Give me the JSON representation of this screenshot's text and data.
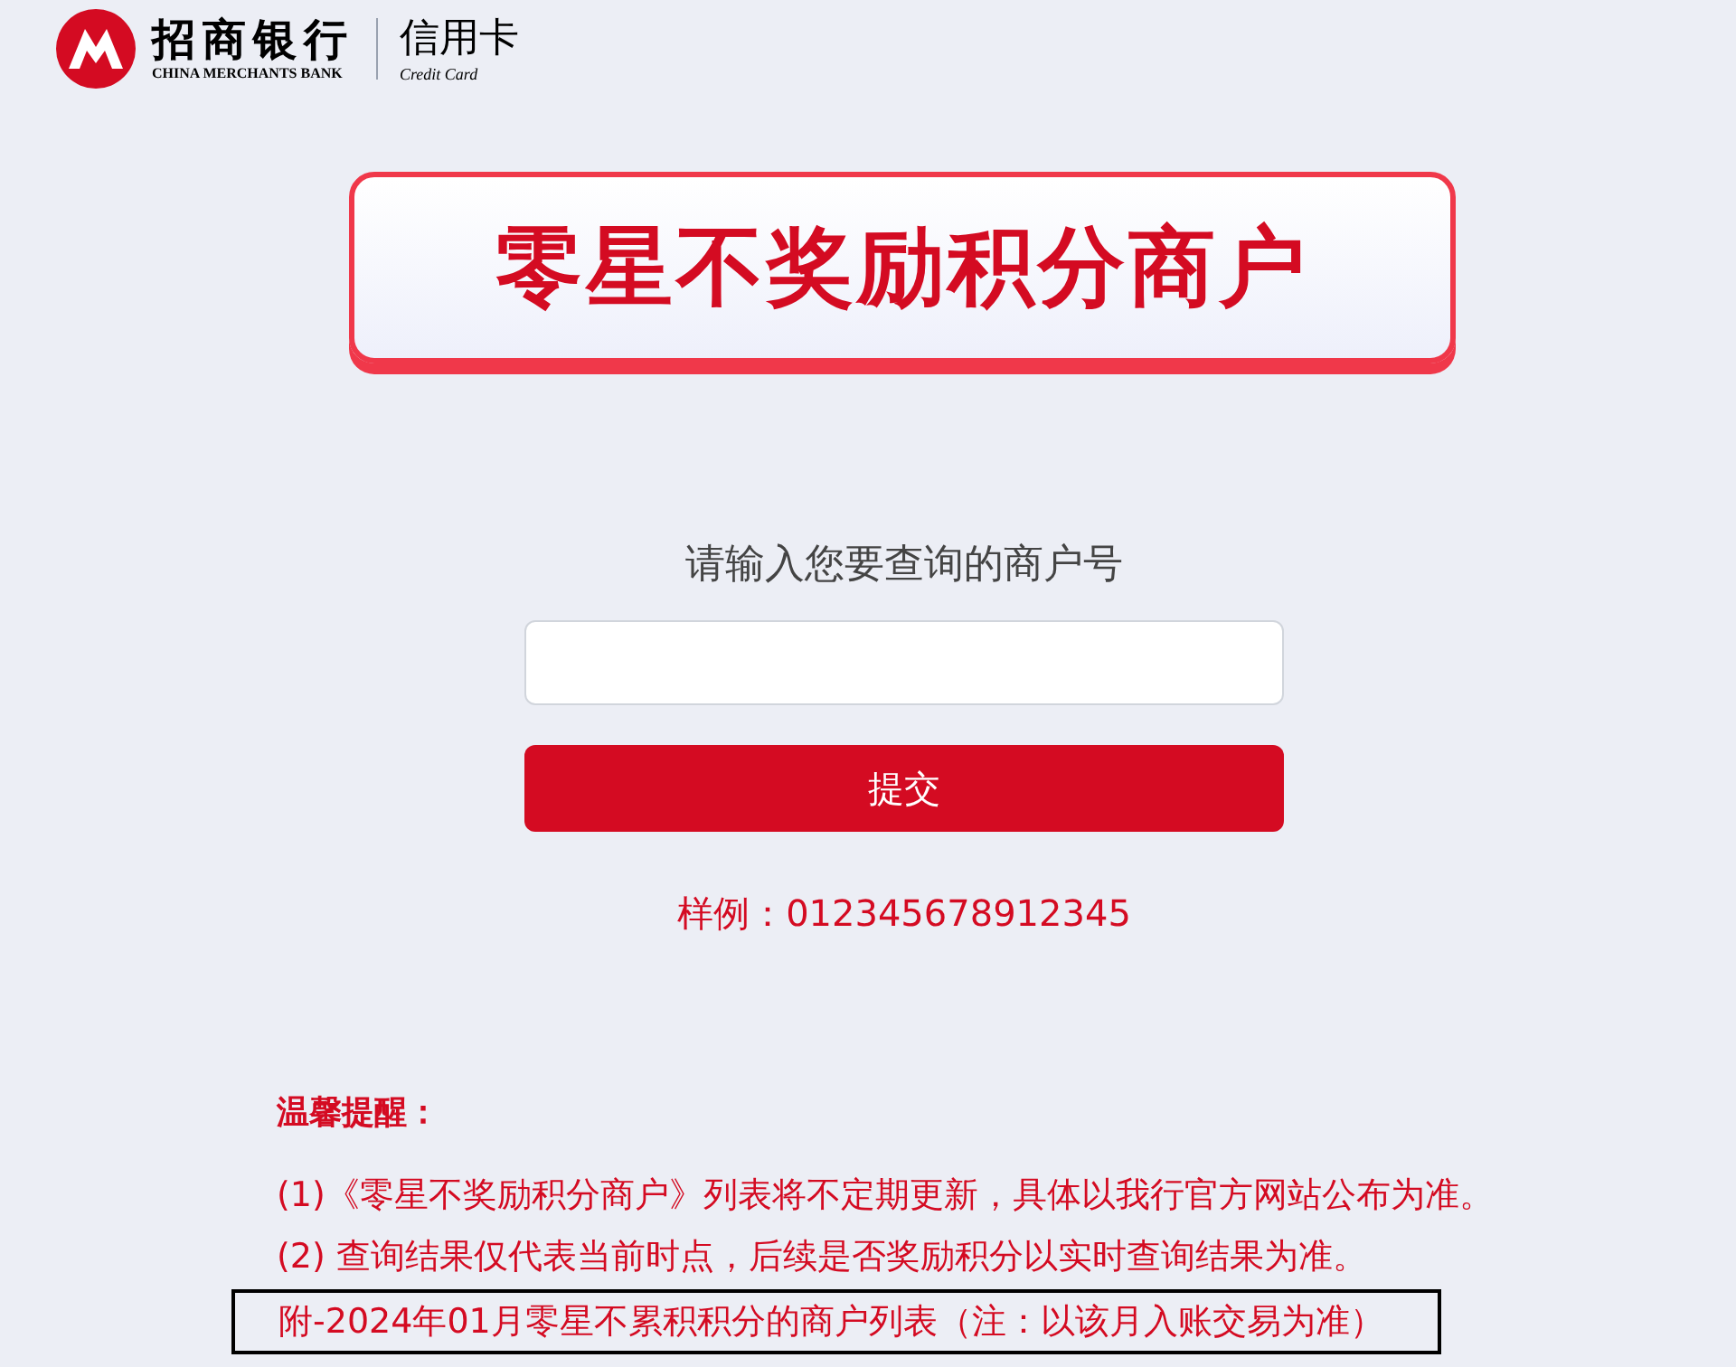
{
  "logo": {
    "bank_name": "招商银行",
    "bank_name_en": "CHINA MERCHANTS BANK",
    "product": "信用卡",
    "product_en": "Credit Card"
  },
  "banner": {
    "title": "零星不奖励积分商户"
  },
  "form": {
    "label": "请输入您要查询的商户号",
    "submit": "提交",
    "example": "样例：012345678912345"
  },
  "notes": {
    "heading": "温馨提醒：",
    "items": [
      "(1)《零星不奖励积分商户》列表将不定期更新，具体以我行官方网站公布为准。",
      "(2) 查询结果仅代表当前时点，后续是否奖励积分以实时查询结果为准。"
    ],
    "link": {
      "text": "附-2024年01月零星不累积积分的商户列表（注：以该月入账交易为准）",
      "selected": true
    }
  }
}
